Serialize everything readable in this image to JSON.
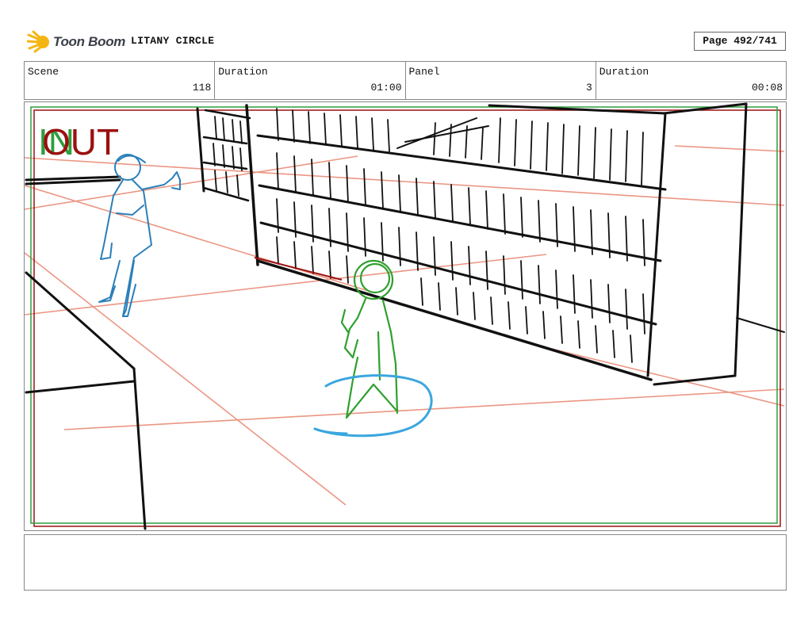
{
  "header": {
    "logo_text": "Toon Boom",
    "project_title": "LITANY CIRCLE",
    "page_label": "Page 492/741"
  },
  "info": [
    {
      "label": "Scene",
      "value": "118"
    },
    {
      "label": "Duration",
      "value": "01:00"
    },
    {
      "label": "Panel",
      "value": "3"
    },
    {
      "label": "Duration",
      "value": "00:08"
    }
  ],
  "panel": {
    "in_label": "IN",
    "out_label": "OUT",
    "colors": {
      "in": "#2e9e3e",
      "out": "#9b1010",
      "perspective": "#e8846e",
      "character_blue": "#2a7fb8",
      "character_green": "#2ea02e",
      "ink": "#111111"
    }
  },
  "notes": {
    "text": ""
  }
}
